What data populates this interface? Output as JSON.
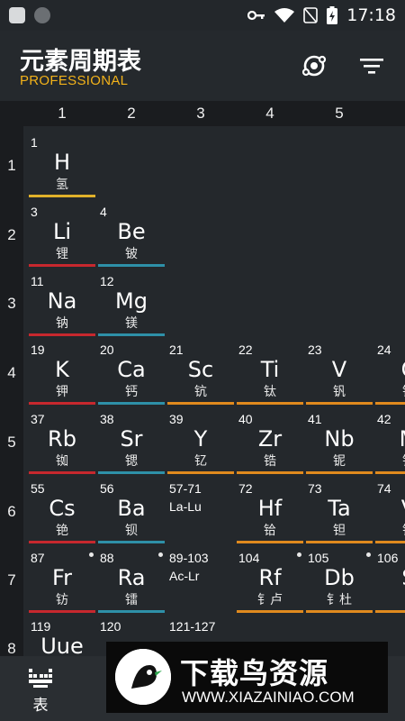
{
  "status_bar": {
    "time": "17:18"
  },
  "app_bar": {
    "title": "元素周期表",
    "subtitle": "PROFESSIONAL"
  },
  "columns": [
    "1",
    "2",
    "3",
    "4",
    "5"
  ],
  "rows": [
    "1",
    "2",
    "3",
    "4",
    "5",
    "6",
    "7",
    "8"
  ],
  "colors": {
    "hydrogen": "#e0b12a",
    "alkali": "#c7282e",
    "alkaline_earth": "#2e90a8",
    "transition": "#e08a1e",
    "accent": "#f2b21a"
  },
  "elements": {
    "h": {
      "number": "1",
      "symbol": "H",
      "name": "氢"
    },
    "li": {
      "number": "3",
      "symbol": "Li",
      "name": "锂"
    },
    "be": {
      "number": "4",
      "symbol": "Be",
      "name": "铍"
    },
    "na": {
      "number": "11",
      "symbol": "Na",
      "name": "钠"
    },
    "mg": {
      "number": "12",
      "symbol": "Mg",
      "name": "镁"
    },
    "k": {
      "number": "19",
      "symbol": "K",
      "name": "钾"
    },
    "ca": {
      "number": "20",
      "symbol": "Ca",
      "name": "钙"
    },
    "sc": {
      "number": "21",
      "symbol": "Sc",
      "name": "钪"
    },
    "ti": {
      "number": "22",
      "symbol": "Ti",
      "name": "钛"
    },
    "v": {
      "number": "23",
      "symbol": "V",
      "name": "钒"
    },
    "cr": {
      "number": "24",
      "symbol": "C",
      "name": "铬"
    },
    "rb": {
      "number": "37",
      "symbol": "Rb",
      "name": "铷"
    },
    "sr": {
      "number": "38",
      "symbol": "Sr",
      "name": "锶"
    },
    "y": {
      "number": "39",
      "symbol": "Y",
      "name": "钇"
    },
    "zr": {
      "number": "40",
      "symbol": "Zr",
      "name": "锆"
    },
    "nb": {
      "number": "41",
      "symbol": "Nb",
      "name": "铌"
    },
    "mo": {
      "number": "42",
      "symbol": "M",
      "name": "钼"
    },
    "cs": {
      "number": "55",
      "symbol": "Cs",
      "name": "铯"
    },
    "ba": {
      "number": "56",
      "symbol": "Ba",
      "name": "钡"
    },
    "la_lu": {
      "range": "57-71",
      "label": "La-Lu"
    },
    "hf": {
      "number": "72",
      "symbol": "Hf",
      "name": "铪"
    },
    "ta": {
      "number": "73",
      "symbol": "Ta",
      "name": "钽"
    },
    "w": {
      "number": "74",
      "symbol": "V",
      "name": "钨"
    },
    "fr": {
      "number": "87",
      "symbol": "Fr",
      "name": "钫"
    },
    "ra": {
      "number": "88",
      "symbol": "Ra",
      "name": "镭"
    },
    "ac_lr": {
      "range": "89-103",
      "label": "Ac-Lr"
    },
    "rf": {
      "number": "104",
      "symbol": "Rf",
      "name": "钅卢"
    },
    "db": {
      "number": "105",
      "symbol": "Db",
      "name": "钅杜"
    },
    "sg": {
      "number": "106",
      "symbol": "S",
      "name": ""
    },
    "uue": {
      "number": "119",
      "symbol": "Uue",
      "name": ""
    },
    "ubn": {
      "number": "120",
      "symbol": "",
      "name": ""
    },
    "r121": {
      "range": "121-127"
    }
  },
  "bottom_nav": {
    "table_label": "表"
  },
  "watermark": {
    "brand": "下载鸟资源",
    "url": "WWW.XIAZAINIAO.COM"
  }
}
